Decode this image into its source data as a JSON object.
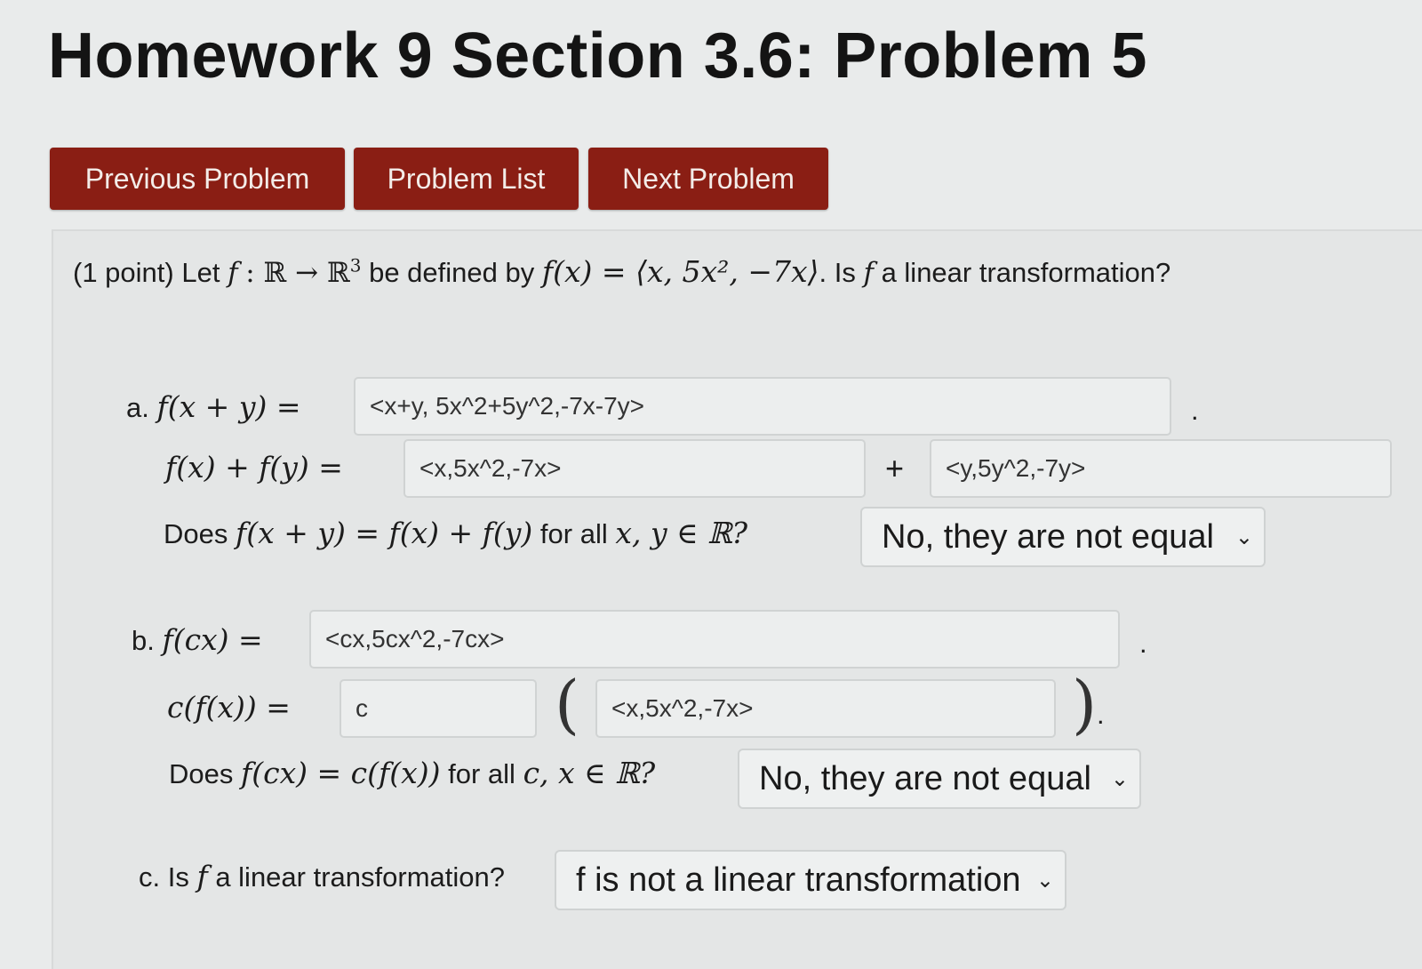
{
  "page": {
    "title": "Homework 9 Section 3.6: Problem 5"
  },
  "nav": {
    "previous_label": "Previous Problem",
    "list_label": "Problem List",
    "next_label": "Next Problem"
  },
  "problem": {
    "points": "(1 point)",
    "let": "Let",
    "f": "f",
    "colon_map": ": ℝ → ℝ",
    "sup3": "3",
    "defined_by": "be defined by",
    "definition": "f(x) = ⟨x, 5x², −7x⟩",
    "question": ". Is",
    "question_tail": "a linear transformation?"
  },
  "part_a": {
    "label": "a.",
    "lhs1": "f(x + y) =",
    "answer_sum": "<x+y, 5x^2+5y^2,-7x-7y>",
    "lhs2": "f(x) + f(y) =",
    "answer_fx": "<x,5x^2,-7x>",
    "plus": "+",
    "answer_fy": "<y,5y^2,-7y>",
    "does_prefix": "Does",
    "does_expr": "f(x + y) = f(x) + f(y)",
    "for_all": "for all",
    "vars": "x, y ∈ ℝ?",
    "select_value": "No, they are not equal"
  },
  "part_b": {
    "label": "b.",
    "lhs1": "f(cx) =",
    "answer_fcx": "<cx,5cx^2,-7cx>",
    "lhs2": "c(f(x)) =",
    "answer_c": "c",
    "answer_fx": "<x,5x^2,-7x>",
    "does_prefix": "Does",
    "does_expr": "f(cx) = c(f(x))",
    "for_all": "for all",
    "vars": "c, x ∈ ℝ?",
    "select_value": "No, they are not equal"
  },
  "part_c": {
    "label": "c. Is",
    "f": "f",
    "question": "a linear transformation?",
    "select_value": "f is not a linear transformation"
  },
  "punctuation": {
    "period": "."
  },
  "icons": {
    "dropdown": "chevron-down-icon"
  }
}
